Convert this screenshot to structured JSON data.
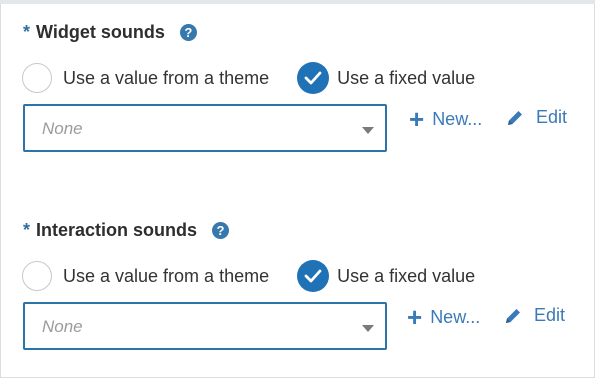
{
  "sections": [
    {
      "required_mark": "*",
      "title": "Widget sounds",
      "help_icon": "question-circle-icon",
      "option_theme": "Use a value from a theme",
      "option_fixed": "Use a fixed value",
      "selected": "fixed",
      "select_value": "None",
      "new_label": "New...",
      "edit_label": "Edit"
    },
    {
      "required_mark": "*",
      "title": "Interaction sounds",
      "help_icon": "question-circle-icon",
      "option_theme": "Use a value from a theme",
      "option_fixed": "Use a fixed value",
      "selected": "fixed",
      "select_value": "None",
      "new_label": "New...",
      "edit_label": "Edit"
    }
  ],
  "colors": {
    "accent": "#1f72b5",
    "link": "#3a7ab8",
    "required": "#2f6f9f"
  }
}
